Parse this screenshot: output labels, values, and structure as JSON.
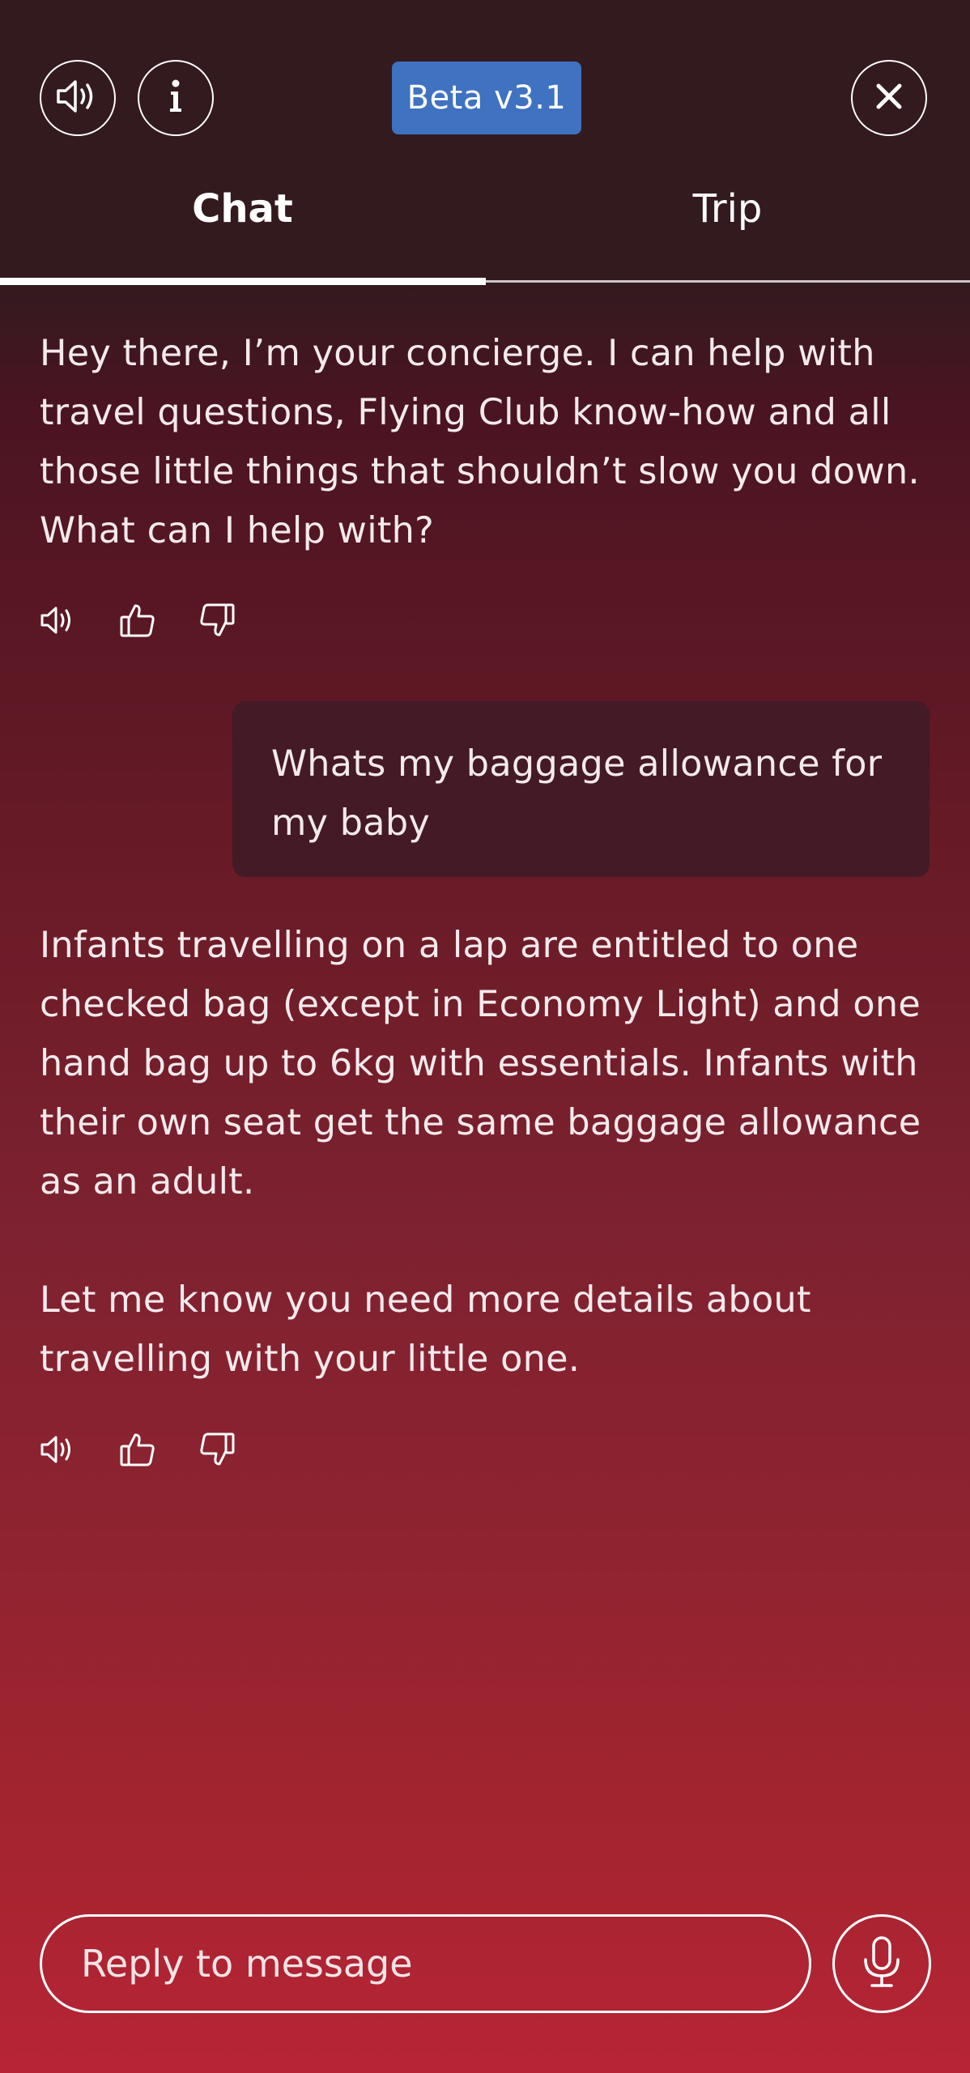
{
  "header": {
    "sound_icon": "speaker-icon",
    "info_icon": "info-icon",
    "badge": "Beta v3.1",
    "badge_color": "#3f72c0",
    "close_icon": "close-icon"
  },
  "tabs": [
    {
      "label": "Chat",
      "active": true
    },
    {
      "label": "Trip",
      "active": false
    }
  ],
  "messages": [
    {
      "from": "assistant",
      "paragraphs": [
        "Hey there, I’m your concierge. I can help with travel questions, Flying Club know-how and all those little things that shouldn’t slow you down. What can I help with?"
      ]
    },
    {
      "from": "user",
      "paragraphs": [
        "Whats my baggage allowance for my baby"
      ]
    },
    {
      "from": "assistant",
      "paragraphs": [
        "Infants travelling on a lap are entitled to one checked bag (except in Economy Light) and one hand bag up to 6kg with essentials. Infants with their own seat get the same baggage allowance as an adult.",
        "Let me know you need more details about travelling with your little one."
      ]
    }
  ],
  "message_actions": [
    "speaker-icon",
    "thumbs-up-icon",
    "thumbs-down-icon"
  ],
  "composer": {
    "placeholder": "Reply to message",
    "mic_icon": "microphone-icon"
  }
}
